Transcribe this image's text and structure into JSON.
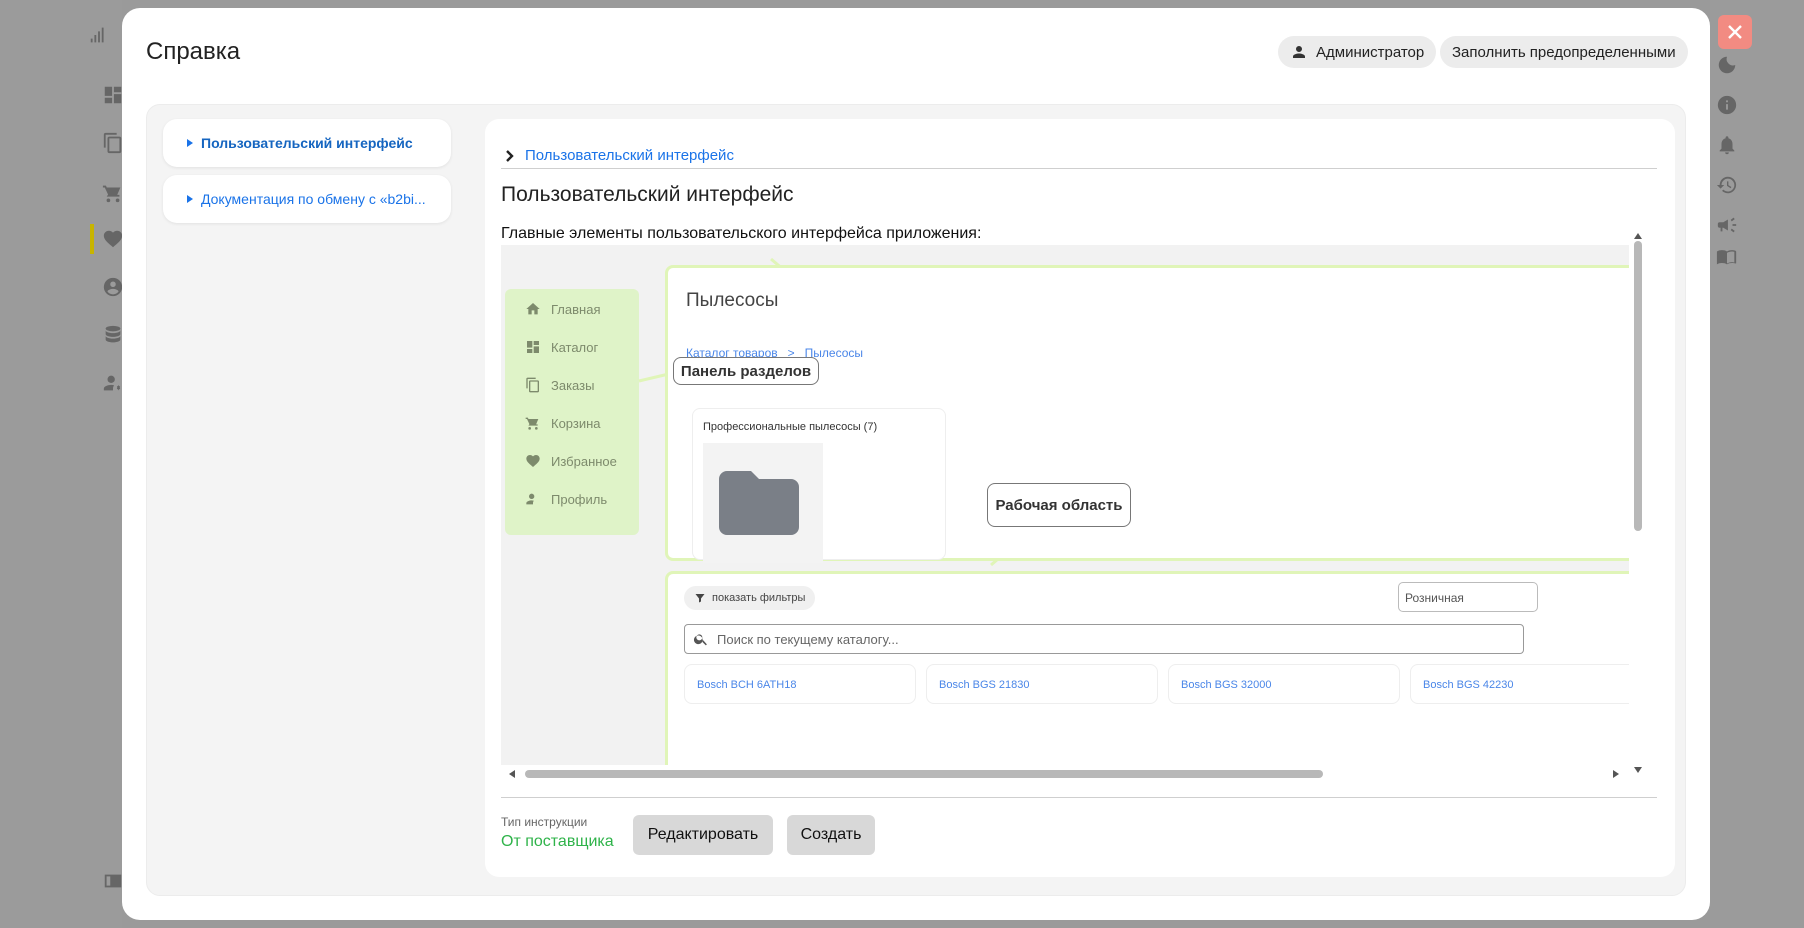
{
  "modal": {
    "title": "Справка",
    "user_button": "Администратор",
    "fill_button": "Заполнить предопределенными"
  },
  "nav": {
    "items": [
      {
        "label": "Пользовательский интерфейс"
      },
      {
        "label": "Документация по обмену с «b2bi..."
      }
    ]
  },
  "article": {
    "breadcrumb": "Пользовательский интерфейс",
    "heading": "Пользовательский интерфейс",
    "lead": "Главные элементы пользовательского интерфейса приложения:"
  },
  "illustration": {
    "sidebar": [
      "Главная",
      "Каталог",
      "Заказы",
      "Корзина",
      "Избранное",
      "Профиль"
    ],
    "page_title": "Пылесосы",
    "breadcrumb": "Каталог товаров   >   Пылесосы",
    "callout_sections": "Панель разделов",
    "callout_work": "Рабочая область",
    "card_title": "Профессиональные пылесосы (7)",
    "filter_button": "показать фильтры",
    "price_select": "Розничная",
    "search_placeholder": "Поиск по текущему каталогу...",
    "products": [
      "Bosch BCH 6ATH18",
      "Bosch BGS 21830",
      "Bosch BGS 32000",
      "Bosch BGS 42230"
    ]
  },
  "footer": {
    "type_label": "Тип инструкции",
    "type_value": "От поставщика",
    "edit_button": "Редактировать",
    "create_button": "Создать"
  },
  "colors": {
    "accent": "#1a73e8",
    "success": "#2fb34a",
    "close": "#f28b82",
    "highlight": "#e0f5b8"
  }
}
